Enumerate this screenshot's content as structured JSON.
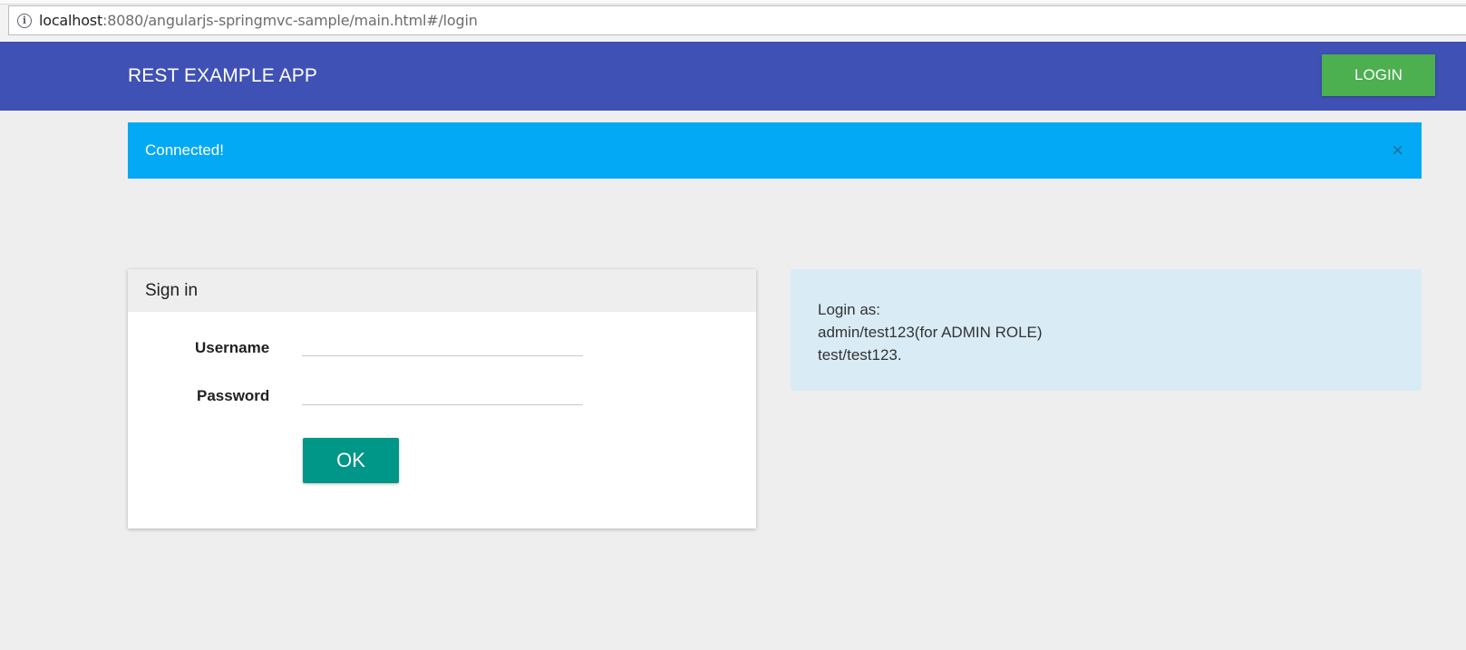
{
  "browser": {
    "url_host": "localhost",
    "url_rest": ":8080/angularjs-springmvc-sample/main.html#/login",
    "info_icon": "info-icon"
  },
  "navbar": {
    "brand": "REST EXAMPLE APP",
    "login_label": "LOGIN",
    "bg_color": "#3f51b5",
    "login_color": "#4caf50"
  },
  "alert": {
    "message": "Connected!",
    "close_symbol": "×",
    "bg_color": "#03a9f4"
  },
  "signin": {
    "heading": "Sign in",
    "username_label": "Username",
    "username_value": "",
    "password_label": "Password",
    "password_value": "",
    "ok_label": "OK",
    "ok_color": "#009688"
  },
  "info": {
    "lines": [
      "Login as:",
      "admin/test123(for ADMIN ROLE)",
      "test/test123."
    ],
    "bg_color": "#d9ecf6"
  }
}
